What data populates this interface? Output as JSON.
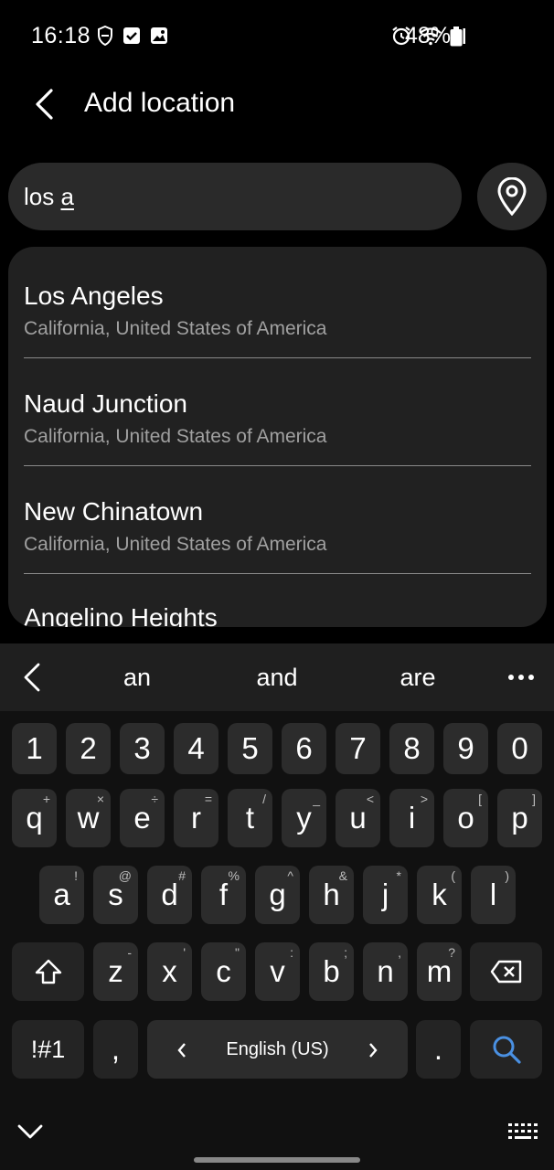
{
  "status": {
    "time": "16:18",
    "battery": "48%",
    "icons_left": [
      "shield-icon",
      "checkbox-icon",
      "gallery-icon"
    ],
    "icons_right": [
      "alarm-icon",
      "wifi-icon",
      "signal-icon",
      "battery-icon"
    ]
  },
  "header": {
    "title": "Add location"
  },
  "search": {
    "prefix": "los ",
    "typed": "a"
  },
  "results": [
    {
      "name": "Los Angeles",
      "sub": "California, United States of America"
    },
    {
      "name": "Naud Junction",
      "sub": "California, United States of America"
    },
    {
      "name": "New Chinatown",
      "sub": "California, United States of America"
    }
  ],
  "results_partial": "Angelino Heights",
  "keyboard": {
    "suggestions": [
      "an",
      "and",
      "are"
    ],
    "numbers": [
      "1",
      "2",
      "3",
      "4",
      "5",
      "6",
      "7",
      "8",
      "9",
      "0"
    ],
    "row1": [
      {
        "k": "q",
        "s": "+"
      },
      {
        "k": "w",
        "s": "×"
      },
      {
        "k": "e",
        "s": "÷"
      },
      {
        "k": "r",
        "s": "="
      },
      {
        "k": "t",
        "s": "/"
      },
      {
        "k": "y",
        "s": "_"
      },
      {
        "k": "u",
        "s": "<"
      },
      {
        "k": "i",
        "s": ">"
      },
      {
        "k": "o",
        "s": "["
      },
      {
        "k": "p",
        "s": "]"
      }
    ],
    "row2": [
      {
        "k": "a",
        "s": "!"
      },
      {
        "k": "s",
        "s": "@"
      },
      {
        "k": "d",
        "s": "#"
      },
      {
        "k": "f",
        "s": "%"
      },
      {
        "k": "g",
        "s": "^"
      },
      {
        "k": "h",
        "s": "&"
      },
      {
        "k": "j",
        "s": "*"
      },
      {
        "k": "k",
        "s": "("
      },
      {
        "k": "l",
        "s": ")"
      }
    ],
    "row3": [
      {
        "k": "z",
        "s": "-"
      },
      {
        "k": "x",
        "s": "'"
      },
      {
        "k": "c",
        "s": "\""
      },
      {
        "k": "v",
        "s": ":"
      },
      {
        "k": "b",
        "s": ";"
      },
      {
        "k": "n",
        "s": ","
      },
      {
        "k": "m",
        "s": "?"
      }
    ],
    "symbols_label": "!#1",
    "comma": ",",
    "language": "English (US)",
    "period": ".",
    "accent": "#4a90e2"
  }
}
